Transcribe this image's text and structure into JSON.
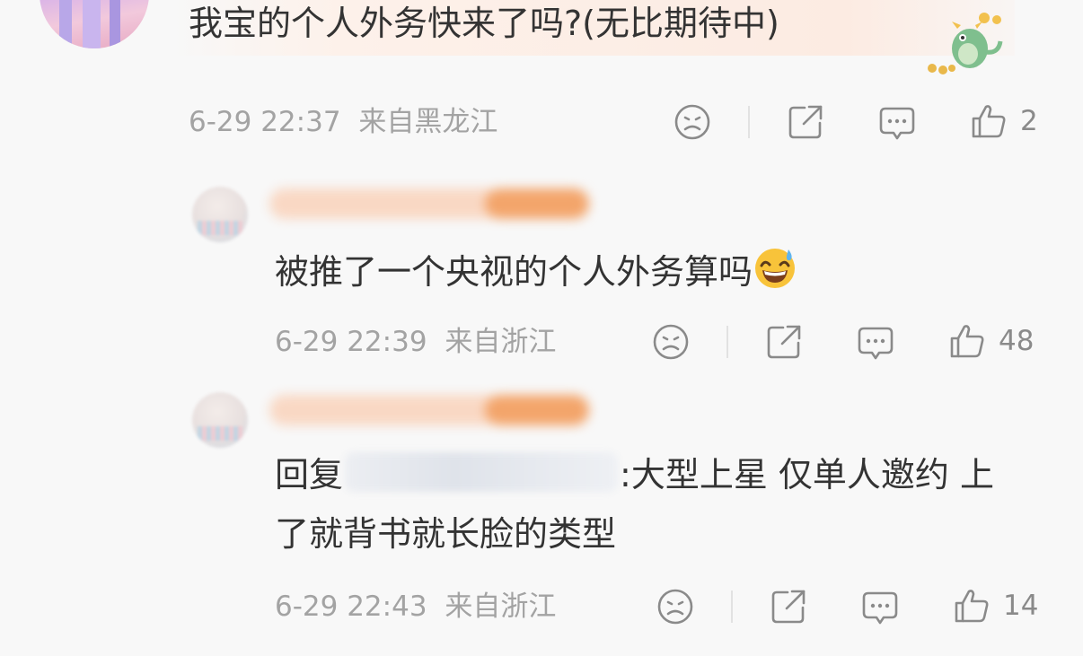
{
  "top_comment": {
    "text": "我宝的个人外务快来了吗?(无比期待中)",
    "time": "6-29 22:37",
    "location": "来自黑龙江",
    "likes": "2"
  },
  "replies": [
    {
      "text": "被推了一个央视的个人外务算吗",
      "emoji": "grinning-sweat-emoji",
      "time": "6-29 22:39",
      "location": "来自浙江",
      "likes": "48"
    },
    {
      "text_prefix": "回复",
      "text_suffix": ":大型上星 仅单人邀约 上",
      "text_line2": "了就背书就长脸的类型",
      "time": "6-29 22:43",
      "location": "来自浙江",
      "likes": "14"
    }
  ],
  "icons": {
    "dislike": "sad-face-icon",
    "share": "share-icon",
    "comment": "comment-icon",
    "like": "thumbs-up-icon"
  },
  "colors": {
    "text": "#333333",
    "meta": "#a3a3a3",
    "icon": "#8a8a8a",
    "background": "#f8f8f8",
    "name_mask": "#f3a56b"
  }
}
